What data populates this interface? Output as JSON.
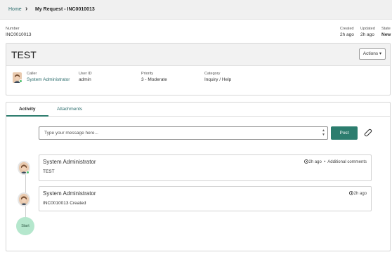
{
  "breadcrumb": {
    "home": "Home",
    "separator": "›",
    "current": "My Request - INC0010013"
  },
  "record": {
    "number_label": "Number",
    "number_value": "INC0010013",
    "created_label": "Created",
    "created_value": "2h ago",
    "updated_label": "Updated",
    "updated_value": "2h ago",
    "state_label": "State",
    "state_value": "New",
    "title": "TEST",
    "actions_label": "Actions ▾",
    "caller_label": "Caller",
    "caller_value": "System Administrator",
    "userid_label": "User ID",
    "userid_value": "admin",
    "priority_label": "Priority",
    "priority_value": "3 - Moderate",
    "category_label": "Category",
    "category_value": "Inquiry / Help"
  },
  "tabs": [
    {
      "label": "Activity",
      "active": true
    },
    {
      "label": "Attachments",
      "active": false
    }
  ],
  "composer": {
    "placeholder": "Type your message here...",
    "post_label": "Post",
    "attach_icon": "paperclip-icon"
  },
  "entries": [
    {
      "author": "System Administrator",
      "time": "2h ago",
      "kind": "Additional comments",
      "body": "TEST"
    },
    {
      "author": "System Administrator",
      "time": "2h ago",
      "kind": "",
      "body": "INC0010013 Created"
    }
  ],
  "timeline": {
    "start_label": "Start"
  },
  "colors": {
    "accent": "#2c7d6e",
    "link": "#2a6b6b",
    "online": "#4bbf6b",
    "start_node": "#b5e7cd"
  }
}
